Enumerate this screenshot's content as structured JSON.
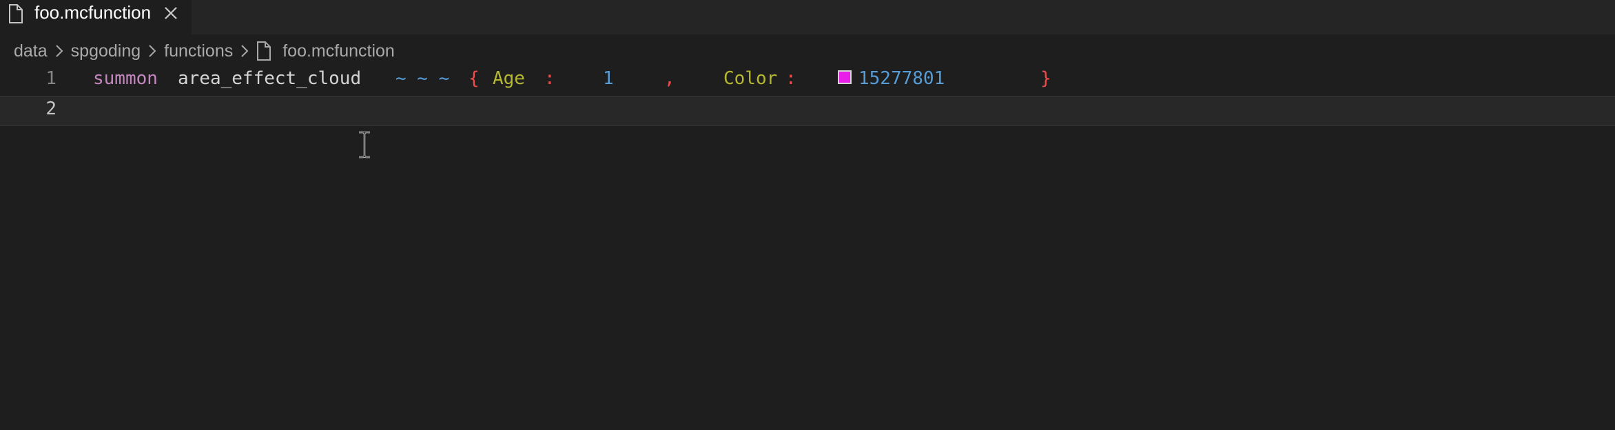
{
  "tab": {
    "label": "foo.mcfunction",
    "file_icon": "file-icon",
    "close_icon": "close-icon"
  },
  "breadcrumb": {
    "items": [
      "data",
      "spgoding",
      "functions",
      "foo.mcfunction"
    ],
    "separator_icon": "chevron-right-icon"
  },
  "editor": {
    "line_numbers": [
      "1",
      "2"
    ],
    "line1_tokens": {
      "summon": "summon",
      "entity": "area_effect_cloud",
      "coords": "~ ~ ~",
      "open_brace": "{",
      "age_key": "Age",
      "age_colon": ":",
      "age_value": "1",
      "comma": ",",
      "color_key": "Color",
      "color_colon": ":",
      "color_value": "15277801",
      "close_brace": "}"
    },
    "color_swatch": "#e91ee9",
    "token_colors": {
      "keyword": "#c586c0",
      "text": "#d4d4d4",
      "coords": "#569cd6",
      "brace": "#f14c4c",
      "key": "#b5b830",
      "number": "#569cd6"
    }
  }
}
